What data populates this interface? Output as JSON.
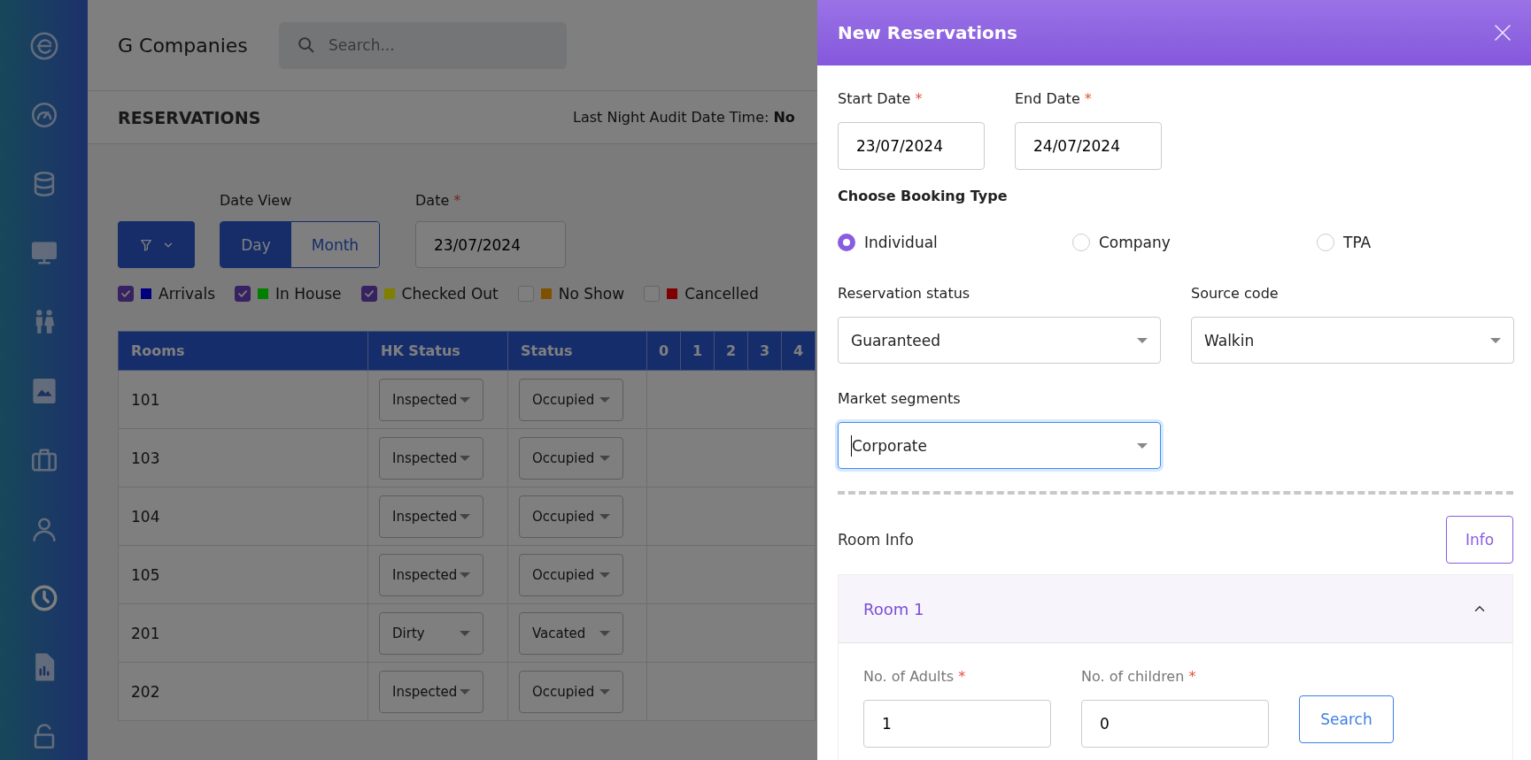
{
  "sidebar": {
    "items": [
      {
        "selected": false
      },
      {
        "selected": false
      },
      {
        "selected": false
      },
      {
        "selected": false
      },
      {
        "selected": false
      },
      {
        "selected": false
      },
      {
        "selected": false
      },
      {
        "selected": false
      },
      {
        "selected": true
      },
      {
        "selected": false
      },
      {
        "selected": false
      }
    ]
  },
  "header": {
    "company": "G Companies",
    "search": {
      "placeholder": "Search..."
    }
  },
  "page": {
    "title": "RESERVATIONS",
    "audit_label": "Last Night Audit Date Time:",
    "audit_value": "No"
  },
  "filters": {
    "date_view": {
      "label": "Date View",
      "options": [
        {
          "label": "Day",
          "selected": true
        },
        {
          "label": "Month",
          "selected": false
        }
      ]
    },
    "date": {
      "label": "Date",
      "mark": "*",
      "value": "23/07/2024"
    },
    "legend": [
      {
        "label": "Arrivals",
        "checked": true,
        "color": "#00007f"
      },
      {
        "label": "In House",
        "checked": true,
        "color": "#007f00"
      },
      {
        "label": "Checked Out",
        "checked": true,
        "color": "#7f7f00"
      },
      {
        "label": "No Show",
        "checked": false,
        "color": "#7f5000"
      },
      {
        "label": "Cancelled",
        "checked": false,
        "color": "#7f0000"
      }
    ]
  },
  "table": {
    "columns": [
      "Rooms",
      "HK Status",
      "Status",
      "0",
      "1",
      "2",
      "3",
      "4"
    ],
    "rows": [
      {
        "room": "101",
        "hk_status": "Inspected",
        "status": "Occupied"
      },
      {
        "room": "103",
        "hk_status": "Inspected",
        "status": "Occupied"
      },
      {
        "room": "104",
        "hk_status": "Inspected",
        "status": "Occupied"
      },
      {
        "room": "105",
        "hk_status": "Inspected",
        "status": "Occupied"
      },
      {
        "room": "201",
        "hk_status": "Dirty",
        "status": "Vacated"
      },
      {
        "room": "202",
        "hk_status": "Inspected",
        "status": "Occupied"
      }
    ]
  },
  "drawer": {
    "title": "New Reservations",
    "start_date": {
      "label": "Start Date",
      "mark": "*",
      "value": "23/07/2024"
    },
    "end_date": {
      "label": "End Date",
      "mark": "*",
      "value": "24/07/2024"
    },
    "booking_type": {
      "label": "Choose Booking Type",
      "options": [
        {
          "label": "Individual",
          "selected": true
        },
        {
          "label": "Company",
          "selected": false
        },
        {
          "label": "TPA",
          "selected": false
        }
      ]
    },
    "reservation_status": {
      "label": "Reservation status",
      "value": "Guaranteed"
    },
    "source_code": {
      "label": "Source code",
      "value": "Walkin"
    },
    "market_segments": {
      "label": "Market segments",
      "value": "Corporate",
      "focused": true
    },
    "room_info": {
      "label": "Room Info",
      "button": "Info"
    },
    "rooms": [
      {
        "title": "Room 1",
        "expanded": true,
        "adults": {
          "label": "No. of Adults",
          "mark": "*",
          "value": "1"
        },
        "children": {
          "label": "No. of children",
          "mark": "*",
          "value": "0"
        },
        "search_button": "Search"
      }
    ]
  }
}
